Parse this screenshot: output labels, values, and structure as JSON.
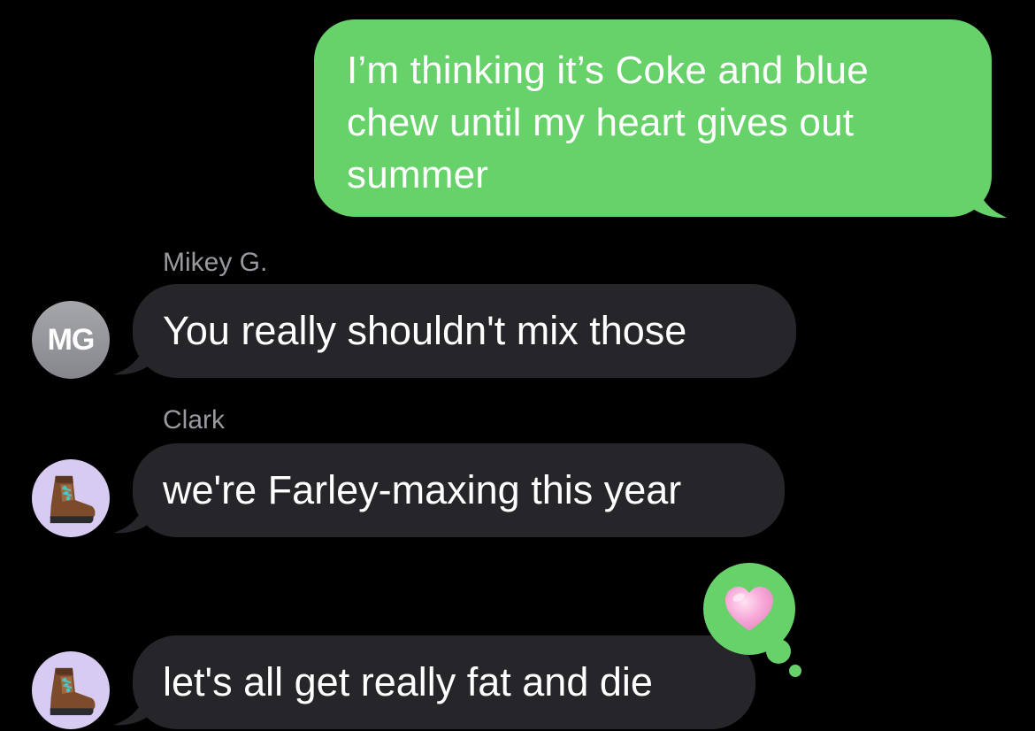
{
  "colors": {
    "background": "#000000",
    "outgoing_bubble": "#67d16a",
    "incoming_bubble": "#26252a",
    "sender_name": "#98989e",
    "text": "#ffffff"
  },
  "messages": [
    {
      "direction": "outgoing",
      "lines": [
        "I’m thinking it’s Coke and blue",
        "chew until my heart gives out",
        "summer"
      ]
    },
    {
      "direction": "incoming",
      "sender": "Mikey G.",
      "avatar": {
        "type": "initials",
        "initials": "MG"
      },
      "text": "You really shouldn't mix those"
    },
    {
      "direction": "incoming",
      "sender": "Clark",
      "avatar": {
        "type": "emoji",
        "icon": "hiking-boot-icon"
      },
      "text": "we're Farley-maxing this year"
    },
    {
      "direction": "incoming",
      "avatar": {
        "type": "emoji",
        "icon": "hiking-boot-icon"
      },
      "text": "let's all get really fat and die",
      "reaction": {
        "icon": "pink-heart-icon",
        "color": "#f7a8d8"
      }
    }
  ]
}
